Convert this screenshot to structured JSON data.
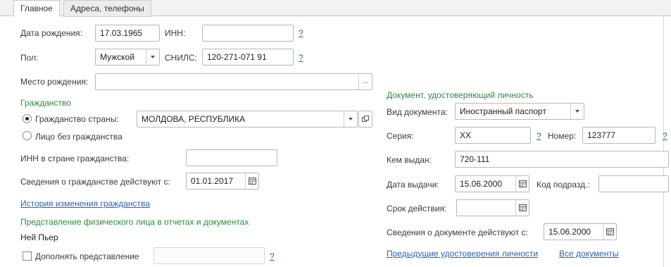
{
  "tabs": [
    {
      "label": "Главное",
      "active": true
    },
    {
      "label": "Адреса, телефоны",
      "active": false
    }
  ],
  "main": {
    "birth_date": {
      "label": "Дата рождения:",
      "value": "17.03.1965"
    },
    "inn": {
      "label": "ИНН:",
      "value": "",
      "help": "?"
    },
    "gender": {
      "label": "Пол:",
      "value": "Мужской"
    },
    "snils": {
      "label": "СНИЛС:",
      "value": "120-271-071 91",
      "help": "?"
    },
    "birth_place": {
      "label": "Место рождения:",
      "value": "",
      "button": "..."
    }
  },
  "citizenship": {
    "header": "Гражданство",
    "radio_country": {
      "label": "Гражданство страны:",
      "selected": true
    },
    "country": "МОЛДОВА, РЕСПУБЛИКА",
    "radio_stateless": {
      "label": "Лицо без гражданства",
      "selected": false
    },
    "inn_country": {
      "label": "ИНН в стране гражданства:",
      "value": ""
    },
    "valid_from": {
      "label": "Сведения о гражданстве действуют с:",
      "value": "01.01.2017"
    },
    "history_link": "История изменения гражданства"
  },
  "representation": {
    "header": "Представление физического лица в отчетах и документах",
    "name": "Ней Пьер",
    "supplement": {
      "label": "Дополнять представление",
      "checked": false,
      "value": "",
      "help": "?"
    }
  },
  "identity": {
    "header": "Документ, удостоверяющий личность",
    "doc_type": {
      "label": "Вид документа:",
      "value": "Иностранный паспорт"
    },
    "series": {
      "label": "Серия:",
      "value": "XX",
      "help": "?"
    },
    "number": {
      "label": "Номер:",
      "value": "123777",
      "help": "?"
    },
    "issued_by": {
      "label": "Кем выдан:",
      "value": "720-111"
    },
    "issue_date": {
      "label": "Дата выдачи:",
      "value": "15.06.2000"
    },
    "dept_code": {
      "label": "Код подразд.:",
      "value": ""
    },
    "expiry": {
      "label": "Срок действия:",
      "value": " .  ."
    },
    "valid_from": {
      "label": "Сведения о документе действуют с:",
      "value": "15.06.2000"
    },
    "prev_link": "Предыдущие удостоверения личности",
    "all_link": "Все документы"
  },
  "colors": {
    "section_header": "#2e8b3c",
    "link": "#2a63b5",
    "border": "#b8b8b8"
  }
}
